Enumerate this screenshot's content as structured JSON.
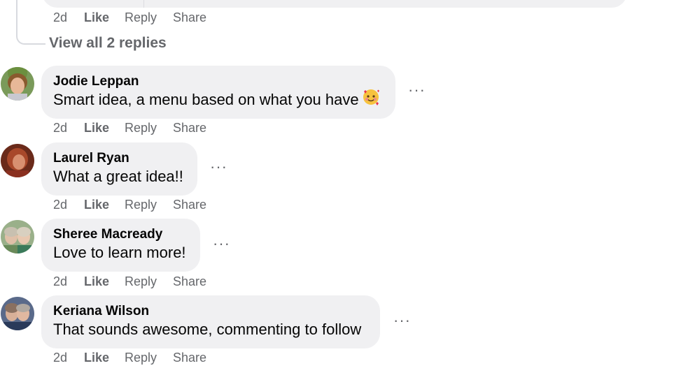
{
  "top_comment": {
    "actions": {
      "time": "2d",
      "like": "Like",
      "reply": "Reply",
      "share": "Share"
    },
    "view_replies": "View all 2 replies"
  },
  "comments": [
    {
      "author": "Jodie Leppan",
      "text": "Smart idea, a menu based on what you have",
      "emoji": "smiling-face-with-hearts-icon",
      "time": "2d",
      "like": "Like",
      "reply": "Reply",
      "share": "Share",
      "more": "···"
    },
    {
      "author": "Laurel Ryan",
      "text": "What a great idea!!",
      "time": "2d",
      "like": "Like",
      "reply": "Reply",
      "share": "Share",
      "more": "···"
    },
    {
      "author": "Sheree Macready",
      "text": "Love to learn more!",
      "time": "2d",
      "like": "Like",
      "reply": "Reply",
      "share": "Share",
      "more": "···"
    },
    {
      "author": "Keriana Wilson",
      "text": "That sounds awesome, commenting to follow",
      "time": "2d",
      "like": "Like",
      "reply": "Reply",
      "share": "Share",
      "more": "···"
    }
  ],
  "colors": {
    "bubble": "#f0f0f2",
    "secondary_text": "#65676b",
    "primary_text": "#050505"
  }
}
